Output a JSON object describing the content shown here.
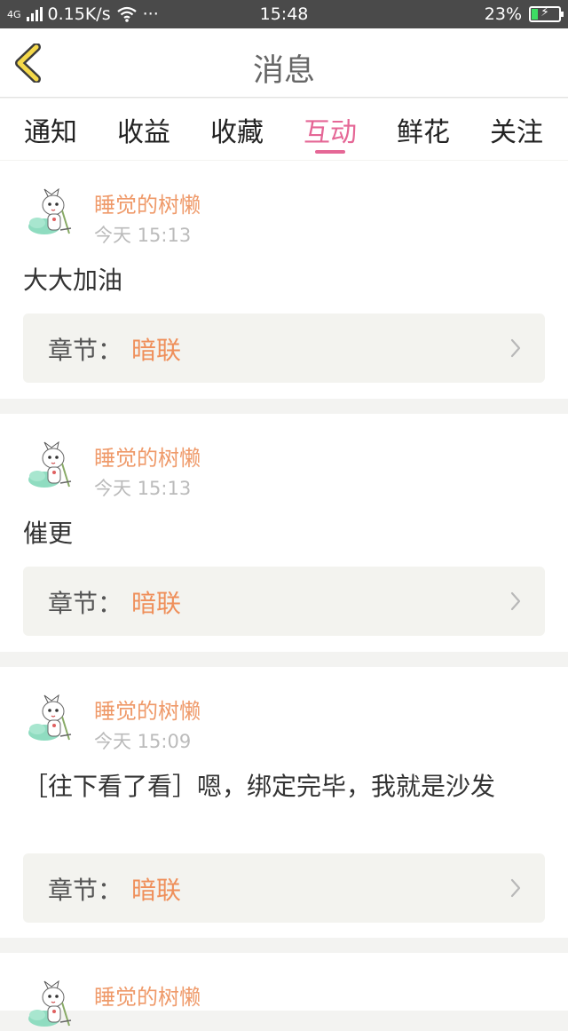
{
  "status_bar": {
    "network_type": "4G",
    "speed": "0.15K/s",
    "more": "···",
    "time": "15:48",
    "battery": "23%",
    "battery_level": 0.23,
    "battery_color": "#3ddc63"
  },
  "nav": {
    "back_icon": "chevron-left-icon",
    "title": "消息"
  },
  "tabs": [
    {
      "label": "通知",
      "active": false
    },
    {
      "label": "收益",
      "active": false
    },
    {
      "label": "收藏",
      "active": false
    },
    {
      "label": "互动",
      "active": true
    },
    {
      "label": "鲜花",
      "active": false
    },
    {
      "label": "关注",
      "active": false
    }
  ],
  "accent_color": "#e56796",
  "messages": [
    {
      "user": "睡觉的树懒",
      "time": "今天 15:13",
      "text": "大大加油",
      "chapter_label": "章节：",
      "chapter_name": "暗联"
    },
    {
      "user": "睡觉的树懒",
      "time": "今天 15:13",
      "text": "催更",
      "chapter_label": "章节：",
      "chapter_name": "暗联"
    },
    {
      "user": "睡觉的树懒",
      "time": "今天 15:09",
      "text": "［往下看了看］嗯，绑定完毕，我就是沙发",
      "chapter_label": "章节：",
      "chapter_name": "暗联"
    },
    {
      "user": "睡觉的树懒"
    }
  ]
}
